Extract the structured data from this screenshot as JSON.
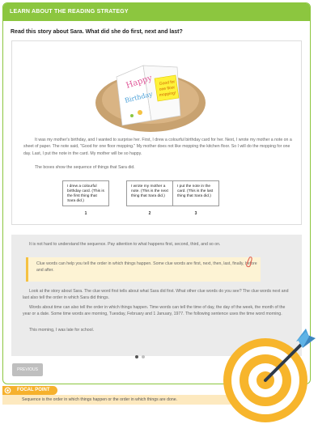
{
  "header": {
    "title": "LEARN ABOUT THE READING STRATEGY"
  },
  "question": "Read this story about Sara. What did she do first, next and last?",
  "card_illustration": {
    "card_text": [
      "Happy",
      "Birthday"
    ],
    "note_text": [
      "Good for",
      "one floor",
      "mopping!"
    ]
  },
  "story": {
    "paragraph_1": "It was my mother's birthday, and I wanted to surprise her. First, I drew a colourful birthday card for her. Next, I wrote my mother a note on a sheet of paper. The note said, \"Good for one floor mopping.\" My mother does not like mopping the kitchen floor. So I will do the mopping for one day. Last, I put the note in the card. My mother will be so happy.",
    "boxes_intro": "The boxes show the sequence of things that Sara did."
  },
  "sequence": [
    {
      "text": "I drew a colourful birthday card. (This is the first thing that Sara did.)",
      "number": "1"
    },
    {
      "text": "I wrote my mother a note. (This is the next thing that Sara did.)",
      "number": "2"
    },
    {
      "text": "I put the note in the card. (This is the last thing that Sara did.)",
      "number": "3"
    }
  ],
  "explanation": {
    "intro": "It is not hard to understand the sequence. Pay attention to what happens first, second, third, and so on.",
    "clue_box": "Clue words can help you tell the order in which things happen. Some clue words are first, next, then, last, finally, before and after.",
    "clue_paragraph": "Look at the story about Sara. The clue word first tells about what Sara did first. What other clue words do you see? The clue words next and last also tell the order in which Sara did things.",
    "time_paragraph": "Words about time can also tell the order in which things happen. Time words can tell the time of day, the day of the week, the month of the year or a date. Some time words are morning, Tuesday, February and 1 January, 1977. The following sentence uses the time word morning.",
    "example": "This morning, I was late for school."
  },
  "buttons": {
    "previous": "PREVIOUS"
  },
  "focal_point": {
    "label": "FOCAL POINT",
    "text": "Sequence is the order in which things happen or the order in which things are done."
  },
  "colors": {
    "accent_green": "#8cc63f",
    "focal_orange": "#f6b12d",
    "target_blue": "#4a9fd8"
  },
  "icons": [
    "paperclip-icon",
    "focal-point-icon",
    "target-icon"
  ],
  "pagination": {
    "current": 1,
    "total": 2
  }
}
